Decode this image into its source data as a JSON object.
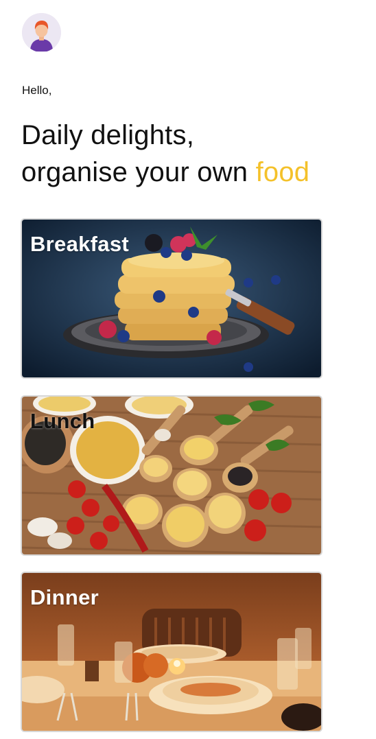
{
  "header": {
    "avatar_icon": "user-avatar-icon",
    "greeting": "Hello,",
    "headline_line1": "Daily delights,",
    "headline_line2_prefix": "organise your own ",
    "headline_line2_accent": "food"
  },
  "colors": {
    "accent": "#f4c12a",
    "text": "#111111",
    "background": "#ffffff"
  },
  "meals": [
    {
      "title": "Breakfast"
    },
    {
      "title": "Lunch"
    },
    {
      "title": "Dinner"
    }
  ]
}
